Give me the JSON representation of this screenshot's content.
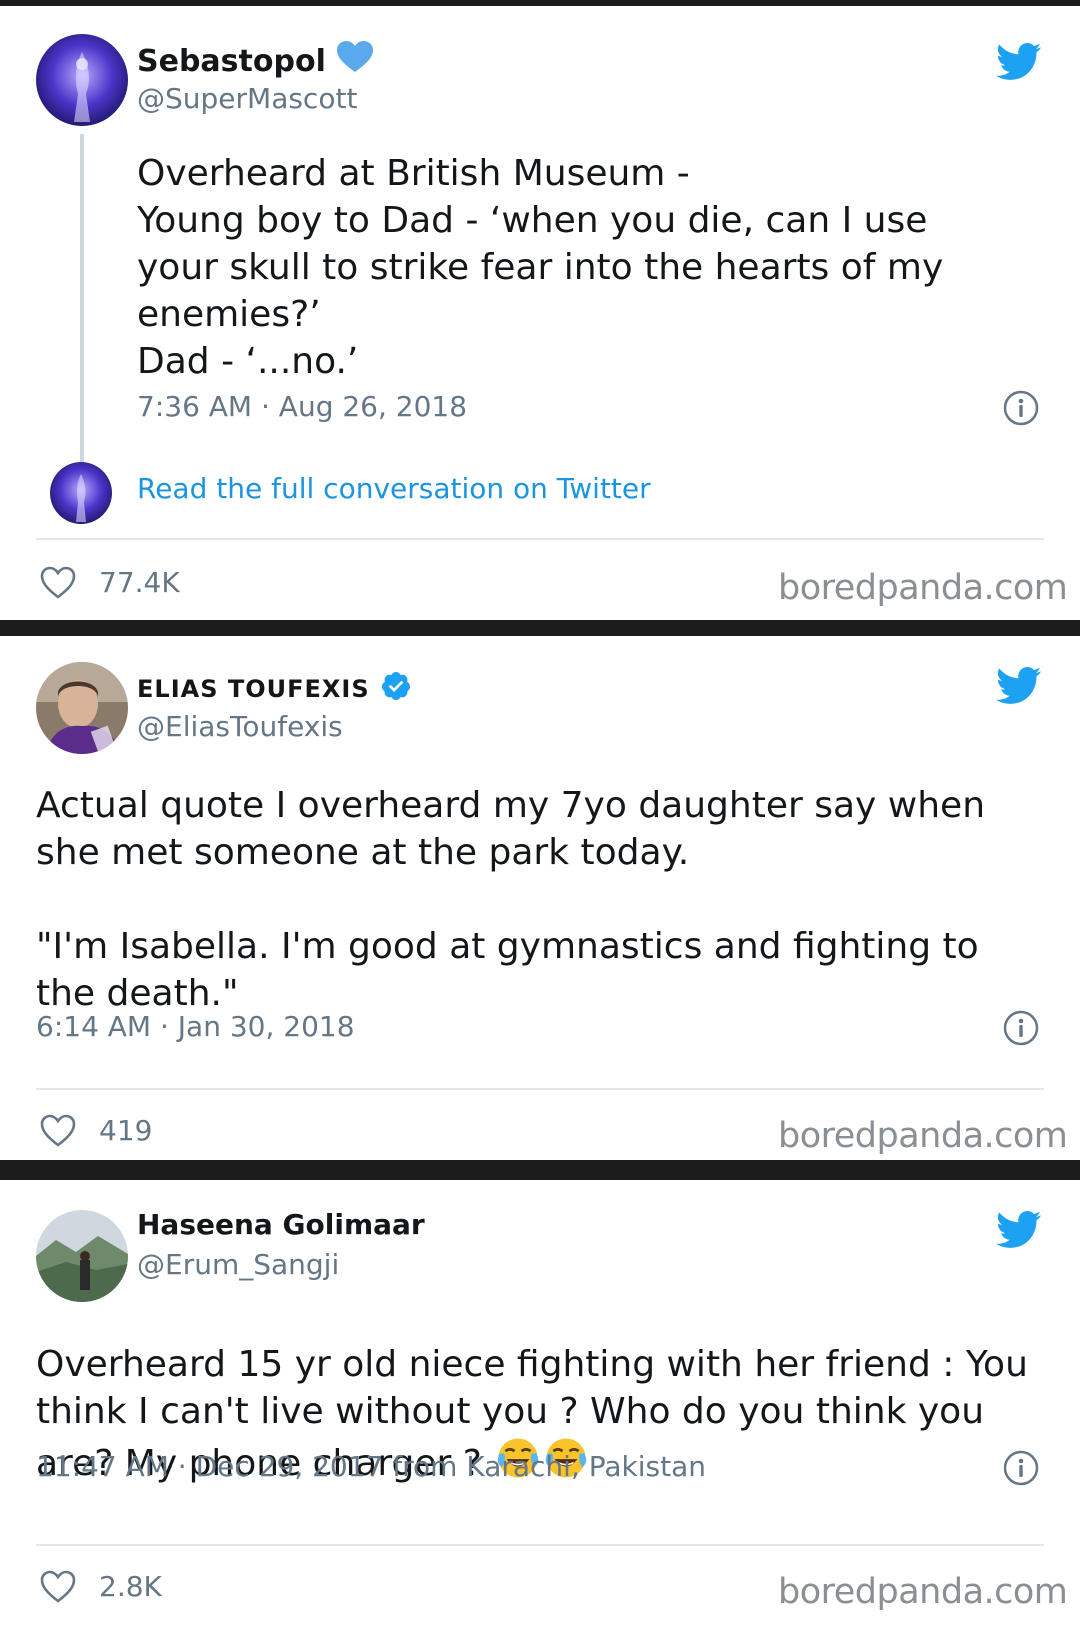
{
  "tweets": [
    {
      "name": "Sebastopol",
      "handle": "@SuperMascott",
      "text": "Overheard at British Museum -\nYoung boy to Dad - ‘when you die, can I use your skull to strike fear into the hearts of my enemies?’\nDad - ‘...no.’",
      "meta": "7:36 AM · Aug 26, 2018",
      "read_link": "Read the full conversation on Twitter",
      "likes": "77.4K",
      "watermark": "boredpanda.com"
    },
    {
      "name": "ELIAS TOUFEXIS",
      "handle": "@EliasToufexis",
      "text": "Actual quote I overheard my 7yo daughter say when she met someone at the park today.\n\n\"I'm Isabella. I'm good at gymnastics and fighting to the death.\"",
      "meta": "6:14 AM · Jan 30, 2018",
      "likes": "419",
      "watermark": "boredpanda.com"
    },
    {
      "name": "Haseena Golimaar",
      "handle": "@Erum_Sangji",
      "text": "Overheard 15 yr old niece fighting with her friend : You think I can't live without you ? Who do you think you are?  My phone charger ? ",
      "meta": "11:47 AM · Dec 29, 2017 from Karachi, Pakistan",
      "likes": "2.8K",
      "watermark": "boredpanda.com"
    }
  ],
  "colors": {
    "twitter_blue": "#1da1f2",
    "link_blue": "#1b95e0",
    "text": "#14171a",
    "muted": "#657786",
    "separator": "#1c1c1c"
  },
  "icons": [
    "twitter-bird-icon",
    "verified-badge-icon",
    "info-icon",
    "heart-icon",
    "laughing-tears-emoji-icon"
  ]
}
